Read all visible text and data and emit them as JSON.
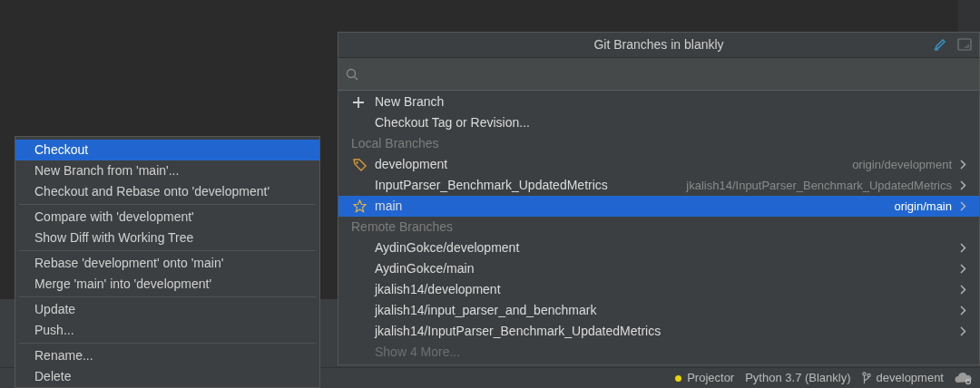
{
  "branches_popup": {
    "title": "Git Branches in blankly",
    "items": [
      {
        "kind": "new_branch",
        "label": "New Branch"
      },
      {
        "kind": "action",
        "label": "Checkout Tag or Revision..."
      },
      {
        "kind": "header",
        "label": "Local Branches"
      },
      {
        "kind": "current_branch",
        "label": "development",
        "tracking": "origin/development",
        "selected": false
      },
      {
        "kind": "branch",
        "label": "InputParser_Benchmark_UpdatedMetrics",
        "tracking": "jkalish14/InputParser_Benchmark_UpdatedMetrics",
        "selected": false
      },
      {
        "kind": "favorite_branch",
        "label": "main",
        "tracking": "origin/main",
        "selected": true
      },
      {
        "kind": "header",
        "label": "Remote Branches"
      },
      {
        "kind": "branch",
        "label": "AydinGokce/development",
        "selected": false
      },
      {
        "kind": "branch",
        "label": "AydinGokce/main",
        "selected": false
      },
      {
        "kind": "branch",
        "label": "jkalish14/development",
        "selected": false
      },
      {
        "kind": "branch",
        "label": "jkalish14/input_parser_and_benchmark",
        "selected": false
      },
      {
        "kind": "branch",
        "label": "jkalish14/InputParser_Benchmark_UpdatedMetrics",
        "selected": false
      },
      {
        "kind": "more",
        "label": "Show 4 More..."
      }
    ]
  },
  "context_menu": {
    "groups": [
      [
        {
          "label": "Checkout",
          "selected": true
        },
        {
          "label": "New Branch from 'main'...",
          "selected": false
        },
        {
          "label": "Checkout and Rebase onto 'development'",
          "selected": false
        }
      ],
      [
        {
          "label": "Compare with 'development'",
          "selected": false
        },
        {
          "label": "Show Diff with Working Tree",
          "selected": false
        }
      ],
      [
        {
          "label": "Rebase 'development' onto 'main'",
          "selected": false
        },
        {
          "label": "Merge 'main' into 'development'",
          "selected": false
        }
      ],
      [
        {
          "label": "Update",
          "selected": false
        },
        {
          "label": "Push...",
          "selected": false
        }
      ],
      [
        {
          "label": "Rename...",
          "selected": false
        },
        {
          "label": "Delete",
          "selected": false
        }
      ]
    ]
  },
  "status_bar": {
    "items": [
      {
        "kind": "projector",
        "label": "Projector",
        "color": "#e5d400"
      },
      {
        "kind": "interpreter",
        "label": "Python 3.7 (Blankly)"
      },
      {
        "kind": "branch",
        "label": "development"
      }
    ]
  }
}
